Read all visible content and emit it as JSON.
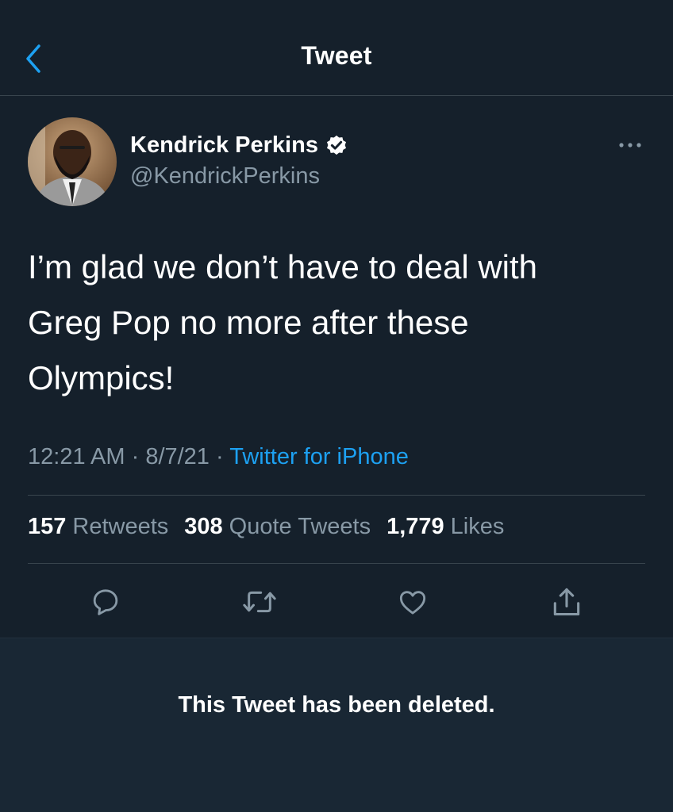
{
  "header": {
    "title": "Tweet"
  },
  "author": {
    "name": "Kendrick Perkins",
    "handle": "@KendrickPerkins",
    "verified": true
  },
  "tweet": {
    "lines": [
      "I’m glad we don’t have to deal with",
      "Greg Pop no more after these",
      "Olympics!"
    ],
    "time": "12:21 AM",
    "separator1": " · ",
    "date": "8/7/21",
    "separator2": " · ",
    "source": "Twitter for iPhone"
  },
  "stats": {
    "retweets_count": "157",
    "retweets_label": "Retweets",
    "quotes_count": "308",
    "quotes_label": "Quote Tweets",
    "likes_count": "1,779",
    "likes_label": "Likes"
  },
  "actions": [
    "reply-icon",
    "retweet-icon",
    "like-icon",
    "share-icon"
  ],
  "notice": {
    "text": "This Tweet has been deleted."
  },
  "colors": {
    "background": "#15202b",
    "accent": "#1da1f2",
    "muted": "#8899a6",
    "divider": "#38444d"
  }
}
